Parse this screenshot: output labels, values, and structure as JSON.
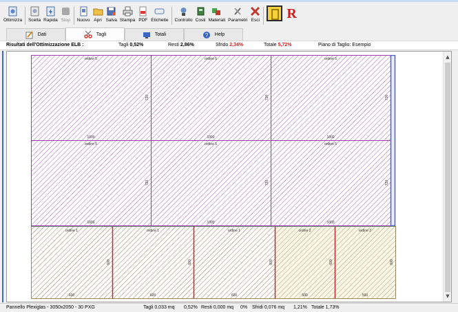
{
  "toolbar": {
    "buttons": [
      {
        "label": "Ottimizza",
        "icon": "optimize-icon",
        "enabled": true
      },
      {
        "label": "Scelta",
        "icon": "choice-icon",
        "enabled": true
      },
      {
        "label": "Rapida",
        "icon": "quick-icon",
        "enabled": true
      },
      {
        "label": "Stop",
        "icon": "stop-icon",
        "enabled": false
      },
      {
        "label": "Nuovo",
        "icon": "new-icon",
        "enabled": true
      },
      {
        "label": "Apri",
        "icon": "open-folder-icon",
        "enabled": true
      },
      {
        "label": "Salva",
        "icon": "save-icon",
        "enabled": true
      },
      {
        "label": "Stampa",
        "icon": "print-icon",
        "enabled": true
      },
      {
        "label": "PDF",
        "icon": "pdf-icon",
        "enabled": true
      },
      {
        "label": "Etichette",
        "icon": "label-icon",
        "enabled": true
      },
      {
        "label": "Controllo",
        "icon": "control-icon",
        "enabled": true
      },
      {
        "label": "Costi",
        "icon": "costs-icon",
        "enabled": true
      },
      {
        "label": "Materiali",
        "icon": "materials-icon",
        "enabled": true
      },
      {
        "label": "Parametri",
        "icon": "parameters-icon",
        "enabled": true
      },
      {
        "label": "Esci",
        "icon": "exit-icon",
        "enabled": true
      }
    ],
    "brand_letter": "R"
  },
  "tabs": [
    {
      "label": "Dati",
      "icon": "data-icon",
      "active": false
    },
    {
      "label": "Tagli",
      "icon": "scissors-icon",
      "active": true
    },
    {
      "label": "Totali",
      "icon": "totals-icon",
      "active": false
    },
    {
      "label": "Help",
      "icon": "help-icon",
      "active": false
    }
  ],
  "results": {
    "title": "Risultati dell'Ottimizzazione ELB :",
    "tagli_label": "Tagli",
    "tagli_value": "0,52%",
    "resti_label": "Resti",
    "resti_value": "2,86%",
    "sfrido_label": "Sfrido",
    "sfrido_value": "2,34%",
    "totale_label": "Totale",
    "totale_value": "5,72%",
    "piano": "Piano di Taglio: Esempio"
  },
  "cutting_plan": {
    "top_rows": [
      {
        "pieces": [
          {
            "order": "ordine 5",
            "width_label": "1000",
            "height_label": "720"
          },
          {
            "order": "ordine 5",
            "width_label": "1000",
            "height_label": "720"
          },
          {
            "order": "ordine 5",
            "width_label": "1000",
            "height_label": "720"
          }
        ]
      },
      {
        "pieces": [
          {
            "order": "ordine 5",
            "width_label": "1000",
            "height_label": "720"
          },
          {
            "order": "ordine 5",
            "width_label": "1000",
            "height_label": "720"
          },
          {
            "order": "ordine 5",
            "width_label": "1000",
            "height_label": "720"
          }
        ]
      }
    ],
    "bottom_row": [
      {
        "order": "ordine 1",
        "width_label": "600",
        "height_label": "600",
        "kind": "ordine1"
      },
      {
        "order": "ordine 1",
        "width_label": "600",
        "height_label": "600",
        "kind": "ordine1"
      },
      {
        "order": "ordine 1",
        "width_label": "600",
        "height_label": "600",
        "kind": "ordine1"
      },
      {
        "order": "ordine 2",
        "width_label": "500",
        "height_label": "600",
        "kind": "ordine2"
      },
      {
        "order": "ordine 2",
        "width_label": "500",
        "height_label": "600",
        "kind": "ordine2"
      }
    ],
    "colors": {
      "ordine5_hatch": "#8e3a9e",
      "ordine5_border": "#a23ab0",
      "ordine1_hatch": "#8a5a2a",
      "ordine1_divider": "#c2272d",
      "ordine2_hatch": "#9a8a5a",
      "ordine2_bg": "#fbf7e6",
      "sheet_edge": "#4a63c9"
    }
  },
  "status": {
    "panel": "Pannello Plexiglas - 3050x2050 - 30 PXG",
    "tagli": "Tagli 0,033 mq",
    "tagli_pct": "0,52%",
    "resti": "Resti 0,000 mq",
    "resti_pct": "0%",
    "sfridi": "Sfridi 0,076 mq",
    "sfridi_pct": "1,21%",
    "totale": "Totale 1,73%"
  }
}
